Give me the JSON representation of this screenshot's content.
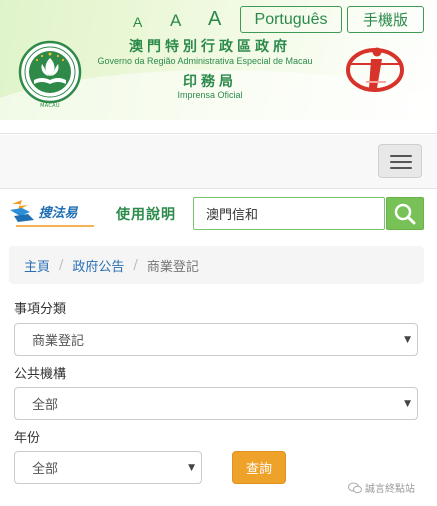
{
  "header": {
    "font_sizes": [
      "A",
      "A",
      "A"
    ],
    "lang_portuguese": "Português",
    "lang_mobile": "手機版",
    "gov_title_zh": "澳門特別行政區政府",
    "gov_title_pt": "Governo da Região Administrativa Especial de Macau",
    "press_title_zh": "印務局",
    "press_title_pt": "Imprensa Oficial",
    "emblem_text": "MACAU"
  },
  "search": {
    "logo_text": "搜法易",
    "help_label": "使用說明",
    "query_value": "澳門信和"
  },
  "breadcrumb": {
    "items": [
      "主頁",
      "政府公告"
    ],
    "current": "商業登記"
  },
  "form": {
    "category_label": "事項分類",
    "category_value": "商業登記",
    "entity_label": "公共機構",
    "entity_value": "全部",
    "year_label": "年份",
    "year_value": "全部",
    "submit_label": "查詢"
  },
  "watermark": "誠言終點站",
  "colors": {
    "brand_green": "#2c8a4b",
    "search_green": "#77c156",
    "link_blue": "#2a6fb3",
    "button_orange": "#efa22a"
  }
}
